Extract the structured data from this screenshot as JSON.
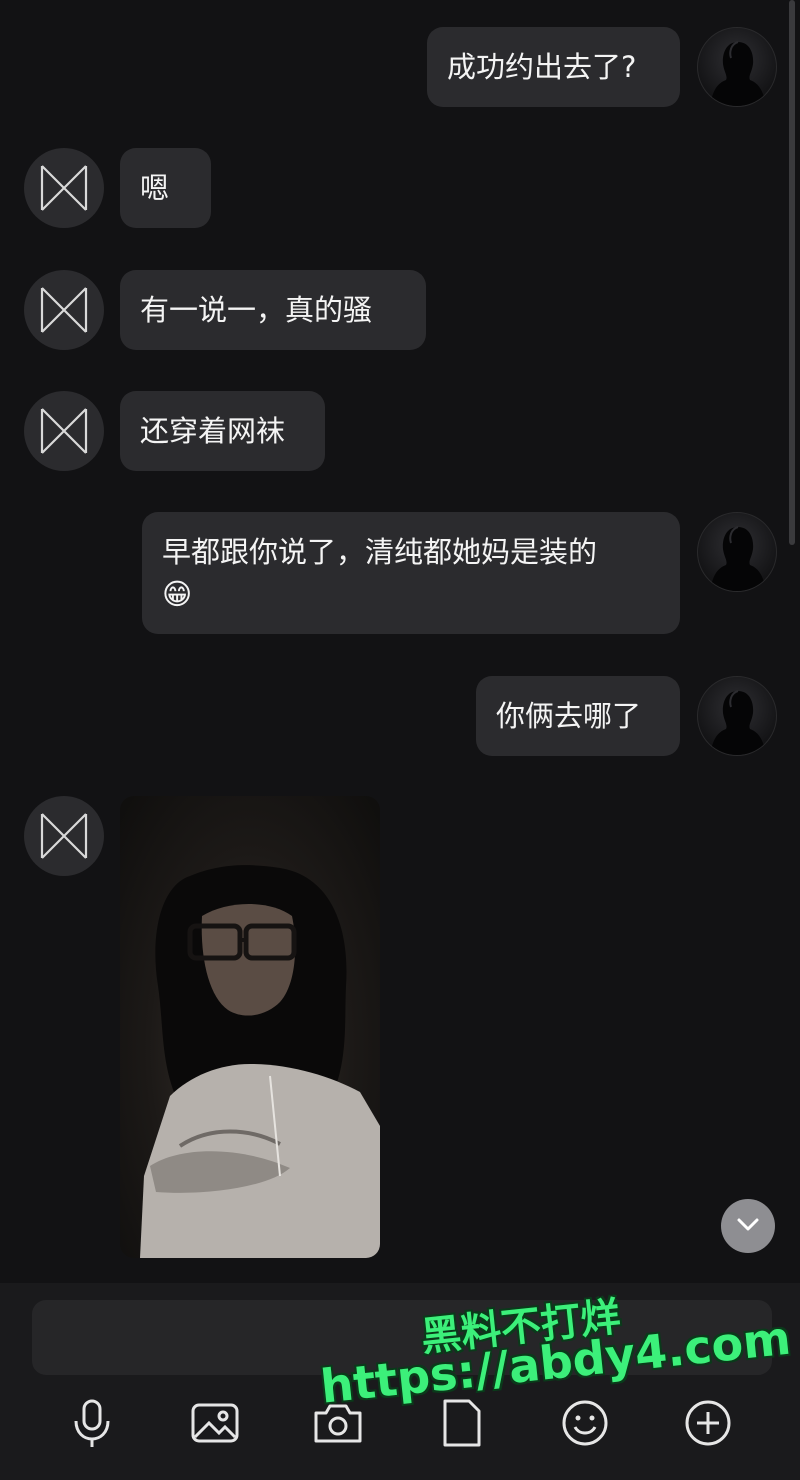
{
  "messages": [
    {
      "side": "me",
      "text": "成功约出去了?"
    },
    {
      "side": "other",
      "text": "嗯"
    },
    {
      "side": "other",
      "text": "有一说一，真的骚"
    },
    {
      "side": "other",
      "text": "还穿着网袜"
    },
    {
      "side": "me",
      "text": "早都跟你说了，清纯都她妈是装的\n😁"
    },
    {
      "side": "me",
      "text": "你俩去哪了"
    },
    {
      "side": "other",
      "type": "image"
    }
  ],
  "toolbar": {
    "icons": [
      "microphone-icon",
      "image-icon",
      "camera-icon",
      "file-icon",
      "emoji-icon",
      "plus-circle-icon"
    ]
  },
  "watermark": {
    "line1": "黑料不打烊",
    "line2": "https://abdy4.com"
  },
  "colors": {
    "background": "#121214",
    "bubble": "#2b2b2e",
    "watermark": "#3cf07a"
  }
}
